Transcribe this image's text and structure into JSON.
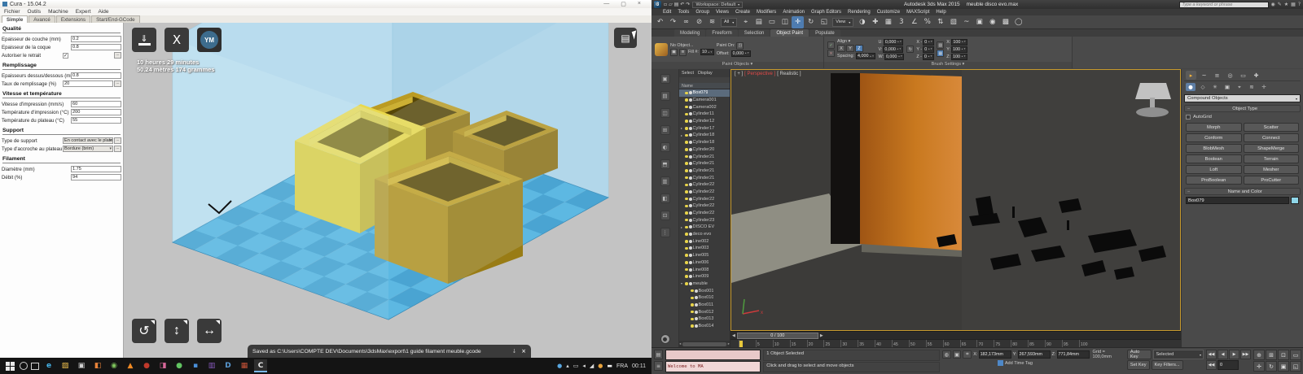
{
  "cura": {
    "title": "Cura - 15.04.2",
    "window_controls": {
      "min": "—",
      "max": "▢",
      "close": "×"
    },
    "menus": [
      "Fichier",
      "Outils",
      "Machine",
      "Expert",
      "Aide"
    ],
    "tabs": [
      {
        "label": "Simple",
        "cls": "active"
      },
      {
        "label": "Avancé"
      },
      {
        "label": "Extensions"
      },
      {
        "label": "Start/End-GCode"
      }
    ],
    "sections": [
      {
        "title": "Qualité",
        "rows": [
          {
            "label": "Epaisseur de couche (mm)",
            "value": "0.2"
          },
          {
            "label": "Epaisseur de la coque",
            "value": "0.8"
          },
          {
            "label": "Autoriser le retrait",
            "kind": "check",
            "cls": "k-check has-more"
          }
        ]
      },
      {
        "title": "Remplissage",
        "rows": [
          {
            "label": "Epaisseurs dessus/dessous (mm)",
            "value": "0.8"
          },
          {
            "label": "Taux de remplissage (%)",
            "value": "20",
            "cls": "has-more"
          }
        ]
      },
      {
        "title": "Vitesse et température",
        "rows": [
          {
            "label": "Vitesse d'impression (mm/s)",
            "value": "60"
          },
          {
            "label": "Température d'impression (°C)",
            "value": "200"
          },
          {
            "label": "Température du plateau (°C)",
            "value": "55"
          }
        ]
      },
      {
        "title": "Support",
        "rows": [
          {
            "label": "Type de support",
            "value": "En contact avec le plateau",
            "cls": "k-select has-more"
          },
          {
            "label": "Type d'accroche au plateau",
            "value": "Bordure (brim)",
            "cls": "k-select has-more"
          }
        ]
      },
      {
        "title": "Filament",
        "rows": [
          {
            "label": "Diamètre (mm)",
            "value": "1.75"
          },
          {
            "label": "Débit (%)",
            "value": "94"
          }
        ]
      }
    ],
    "print_time": "10 heures 29 minutes",
    "print_material": "50.24 mètres 174 grammes",
    "youmagine_label": "YM",
    "icons": {
      "load": "⇓",
      "toolpath": "X",
      "viewmode": "▤",
      "rotate": "↺",
      "scale": "↕",
      "mirror": "↔",
      "download": "↓",
      "close": "×"
    },
    "notification": "Saved as C:\\Users\\COMPTE DEV\\Documents\\3dsMax\\export\\1 guide filament meuble.gcode"
  },
  "taskbar": {
    "apps": [
      {
        "n": "edge-icon",
        "g": "e",
        "color": "#45b3e8"
      },
      {
        "n": "explorer-icon",
        "g": "▨",
        "color": "#f2c24e"
      },
      {
        "n": "camera-icon",
        "g": "▣",
        "color": "#cfcfcf"
      },
      {
        "n": "photos-icon",
        "g": "◧",
        "color": "#e8833a"
      },
      {
        "n": "chrome-icon",
        "g": "◉",
        "color": "#7ec35c"
      },
      {
        "n": "vlc-icon",
        "g": "▲",
        "color": "#f08a24"
      },
      {
        "n": "app-red-icon",
        "g": "●",
        "color": "#c0392b"
      },
      {
        "n": "paint-icon",
        "g": "◨",
        "color": "#d8689a"
      },
      {
        "n": "messaging-icon",
        "g": "●",
        "color": "#62c462"
      },
      {
        "n": "app-blue-icon",
        "g": "▪",
        "color": "#4a90d9"
      },
      {
        "n": "onenote-icon",
        "g": "▥",
        "color": "#8a5cc0"
      },
      {
        "n": "word-icon",
        "g": "D",
        "color": "#5a9bd4"
      },
      {
        "n": "office-icon",
        "g": "▦",
        "color": "#c75338"
      },
      {
        "n": "cura-taskbar-icon",
        "g": "C",
        "color": "#e8e8e8",
        "cls": "active-app"
      }
    ],
    "tray": [
      {
        "n": "onedrive-icon",
        "g": "●",
        "color": "#58a6e0"
      },
      {
        "n": "tray-expand-icon",
        "g": "▴",
        "color": "#ddd"
      },
      {
        "n": "display-icon",
        "g": "▭",
        "color": "#ddd"
      },
      {
        "n": "volume-icon",
        "g": "◂",
        "color": "#ddd"
      },
      {
        "n": "network-icon",
        "g": "◢",
        "color": "#ddd"
      },
      {
        "n": "updates-icon",
        "g": "●",
        "color": "#e8a33d"
      },
      {
        "n": "chat-icon",
        "g": "▬",
        "color": "#eee"
      }
    ],
    "lang": "FRA",
    "time": "00:11"
  },
  "max": {
    "close_extra": "×",
    "logo": "3",
    "workspace": "Workspace: Default",
    "title_app": "Autodesk 3ds Max 2015",
    "title_file": "meuble disco evo.max",
    "search_placeholder": "Type a keyword or phrase",
    "title_icons": [
      {
        "n": "search-icon",
        "g": "◉"
      },
      {
        "n": "sign-in-icon",
        "g": "✎"
      },
      {
        "n": "favorites-icon",
        "g": "★"
      },
      {
        "n": "community-icon",
        "g": "▦"
      },
      {
        "n": "help-icon",
        "g": "?"
      }
    ],
    "qat": [
      {
        "n": "new-scene-icon",
        "g": "▫"
      },
      {
        "n": "open-file-icon",
        "g": "▱"
      },
      {
        "n": "save-file-icon",
        "g": "▤"
      },
      {
        "n": "undo-icon",
        "g": "↶"
      },
      {
        "n": "redo-icon",
        "g": "↷"
      }
    ],
    "menus": [
      "Edit",
      "Tools",
      "Group",
      "Views",
      "Create",
      "Modifiers",
      "Animation",
      "Graph Editors",
      "Rendering",
      "Customize",
      "MAXScript",
      "Help"
    ],
    "toolbar_dd1": "All",
    "toolbar_dd2": "View",
    "toolbar_icons_a": [
      {
        "n": "undo-icon",
        "g": "↶"
      },
      {
        "n": "redo-icon",
        "g": "↷"
      },
      {
        "n": "select-link-icon",
        "g": "∞"
      },
      {
        "n": "unlink-icon",
        "g": "⊘"
      },
      {
        "n": "bind-spacewarp-icon",
        "g": "≋"
      }
    ],
    "toolbar_icons_b": [
      {
        "n": "select-object-icon",
        "g": "⌖"
      },
      {
        "n": "select-by-name-icon",
        "g": "▤"
      },
      {
        "n": "rect-region-icon",
        "g": "▭"
      },
      {
        "n": "window-crossing-icon",
        "g": "◫"
      },
      {
        "n": "move-icon",
        "g": "✛",
        "cls": "hl"
      },
      {
        "n": "rotate-icon",
        "g": "↻"
      },
      {
        "n": "scale-icon",
        "g": "◱"
      }
    ],
    "toolbar_icons_c": [
      {
        "n": "mirror-icon",
        "g": "◑"
      },
      {
        "n": "align-icon",
        "g": "✚"
      },
      {
        "n": "layer-manager-icon",
        "g": "▦"
      },
      {
        "n": "snap-toggle-icon",
        "g": "3"
      },
      {
        "n": "angle-snap-icon",
        "g": "∠"
      },
      {
        "n": "percent-snap-icon",
        "g": "%"
      },
      {
        "n": "spinner-snap-icon",
        "g": "⇅"
      },
      {
        "n": "named-selection-icon",
        "g": "▧"
      },
      {
        "n": "curve-editor-icon",
        "g": "~"
      },
      {
        "n": "schematic-view-icon",
        "g": "▣"
      },
      {
        "n": "material-editor-icon",
        "g": "◉"
      },
      {
        "n": "render-setup-icon",
        "g": "▩"
      },
      {
        "n": "render-icon",
        "g": "◯"
      }
    ],
    "ribbon": {
      "tabs": [
        {
          "label": "Modeling"
        },
        {
          "label": "Freeform"
        },
        {
          "label": "Selection"
        },
        {
          "label": "Object Paint",
          "cls": "active"
        },
        {
          "label": "Populate"
        }
      ],
      "paint_objects": {
        "caption": "Paint Objects ▾",
        "object": "No Object...",
        "paint_on": "Paint On:",
        "fill": "Fill #:",
        "fill_val": "10",
        "offset": "Offset:",
        "offset_val": "0,000"
      },
      "brush": {
        "caption": "Brush Settings ▾",
        "ok": "✓",
        "cancel": "×",
        "align": "Align ▾",
        "axes": [
          {
            "label": "X"
          },
          {
            "label": "Y"
          },
          {
            "label": "Z",
            "cls": "active"
          }
        ],
        "spacing": "Spacing:",
        "spacing_val": "4,000",
        "uvw": [
          {
            "k": "U:",
            "v": "0,000"
          },
          {
            "k": "V:",
            "v": "0,000"
          },
          {
            "k": "W:",
            "v": "0,000"
          }
        ],
        "xyz": [
          {
            "k": "X -",
            "v": "0"
          },
          {
            "k": "Y -",
            "v": "0"
          },
          {
            "k": "Z -",
            "v": "0"
          }
        ],
        "scale": [
          {
            "k": "X:",
            "v": "100"
          },
          {
            "k": "Y:",
            "v": "100"
          },
          {
            "k": "Z:",
            "v": "100"
          }
        ]
      }
    },
    "scene": {
      "menu": [
        "Select",
        "Display"
      ],
      "name_header": "Name",
      "items": [
        {
          "exp": "",
          "label": "Box079",
          "cls": "sel"
        },
        {
          "exp": "",
          "label": "Camera001"
        },
        {
          "exp": "",
          "label": "Camera002"
        },
        {
          "exp": "",
          "label": "Cylinder11"
        },
        {
          "exp": "",
          "label": "Cylinder12"
        },
        {
          "exp": "▸",
          "label": "Cylinder17"
        },
        {
          "exp": "▸",
          "label": "Cylinder18"
        },
        {
          "exp": "",
          "label": "Cylinder18"
        },
        {
          "exp": "",
          "label": "Cylinder20"
        },
        {
          "exp": "",
          "label": "Cylinder21"
        },
        {
          "exp": "",
          "label": "Cylinder21"
        },
        {
          "exp": "",
          "label": "Cylinder21"
        },
        {
          "exp": "",
          "label": "Cylinder21"
        },
        {
          "exp": "",
          "label": "Cylinder22"
        },
        {
          "exp": "",
          "label": "Cylinder22"
        },
        {
          "exp": "",
          "label": "Cylinder22"
        },
        {
          "exp": "",
          "label": "Cylinder22"
        },
        {
          "exp": "",
          "label": "Cylinder22"
        },
        {
          "exp": "",
          "label": "Cylinder23"
        },
        {
          "exp": "▸",
          "label": "DISCO EV"
        },
        {
          "exp": "",
          "label": "deco evo"
        },
        {
          "exp": "",
          "label": "Line002"
        },
        {
          "exp": "",
          "label": "Line003"
        },
        {
          "exp": "",
          "label": "Line005"
        },
        {
          "exp": "",
          "label": "Line006"
        },
        {
          "exp": "",
          "label": "Line008"
        },
        {
          "exp": "",
          "label": "Line009"
        },
        {
          "exp": "▾",
          "label": "meuble"
        },
        {
          "exp": "",
          "label": "Box001",
          "cls": "ind"
        },
        {
          "exp": "",
          "label": "Box010",
          "cls": "ind"
        },
        {
          "exp": "",
          "label": "Box011",
          "cls": "ind"
        },
        {
          "exp": "",
          "label": "Box012",
          "cls": "ind"
        },
        {
          "exp": "",
          "label": "Box013",
          "cls": "ind"
        },
        {
          "exp": "",
          "label": "Box014",
          "cls": "ind"
        }
      ]
    },
    "viewport": {
      "label_plus": "[ + ]",
      "label_view": "[ Perspective ]",
      "label_shading": "[ Realistic ]"
    },
    "cmd": {
      "category": "Compound Objects",
      "object_type": "Object Type",
      "autogrid": "AutoGrid",
      "buttons": [
        {
          "label": "Morph"
        },
        {
          "label": "Scatter"
        },
        {
          "label": "Conform"
        },
        {
          "label": "Connect"
        },
        {
          "label": "BlobMesh"
        },
        {
          "label": "ShapeMerge"
        },
        {
          "label": "Boolean"
        },
        {
          "label": "Terrain"
        },
        {
          "label": "Loft"
        },
        {
          "label": "Mesher"
        },
        {
          "label": "ProBoolean"
        },
        {
          "label": "ProCutter"
        }
      ],
      "name_color": "Name and Color",
      "name_value": "Box079"
    },
    "timeline": {
      "slider": "0 / 100",
      "ticks": [
        "0",
        "5",
        "10",
        "15",
        "20",
        "25",
        "30",
        "35",
        "40",
        "45",
        "50",
        "55",
        "60",
        "65",
        "70",
        "75",
        "80",
        "85",
        "90",
        "95",
        "100"
      ]
    },
    "status": {
      "selected": "1 Object Selected",
      "prompt": "Click and drag to select and move objects",
      "listener": "Welcome to MA",
      "coords": [
        {
          "k": "X:",
          "v": "182,173mm"
        },
        {
          "k": "Y:",
          "v": "267,593mm"
        },
        {
          "k": "Z:",
          "v": "771,84mm"
        }
      ],
      "grid": "Grid = 100,0mm",
      "auto_key": "Auto Key",
      "set_key": "Set Key",
      "selected_dd": "Selected",
      "key_filters": "Key Filters...",
      "add_time_tag": "Add Time Tag",
      "frame": "0"
    },
    "play_icons": [
      {
        "n": "go-to-start-icon",
        "g": "◀◀"
      },
      {
        "n": "prev-frame-icon",
        "g": "◀"
      },
      {
        "n": "play-icon",
        "g": "▶"
      },
      {
        "n": "go-to-end-icon",
        "g": "▶▶"
      }
    ],
    "nav_icons": [
      {
        "n": "zoom-icon",
        "g": "⊕"
      },
      {
        "n": "zoom-all-icon",
        "g": "⊞"
      },
      {
        "n": "zoom-extents-icon",
        "g": "⊡"
      },
      {
        "n": "zoom-region-icon",
        "g": "▭"
      },
      {
        "n": "pan-icon",
        "g": "✛"
      },
      {
        "n": "orbit-icon",
        "g": "↻"
      },
      {
        "n": "field-of-view-icon",
        "g": "▣"
      },
      {
        "n": "maximize-viewport-icon",
        "g": "◱"
      }
    ]
  }
}
